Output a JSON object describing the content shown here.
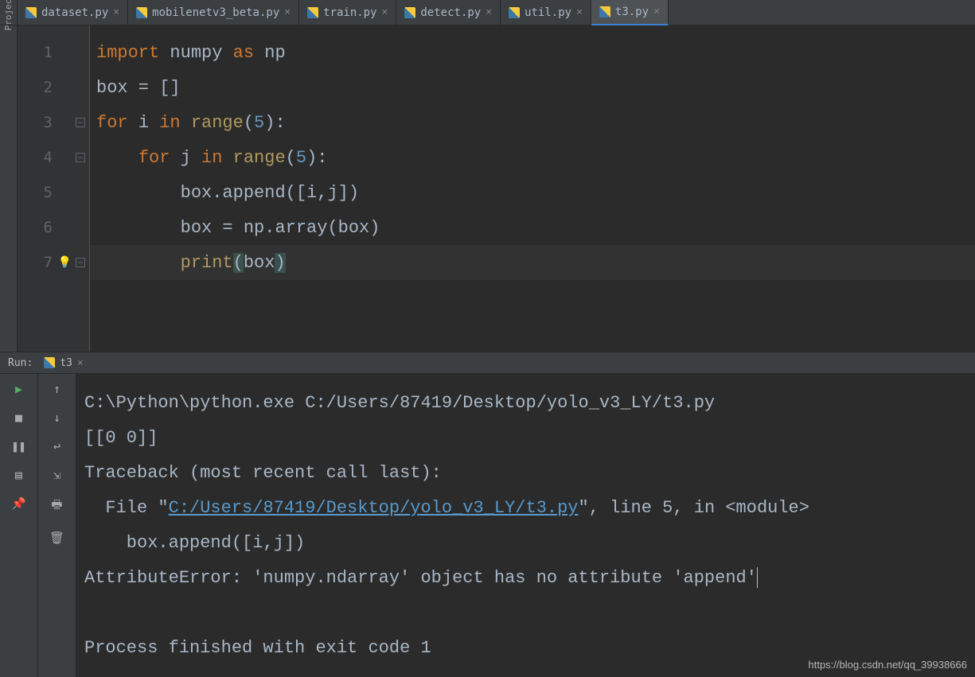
{
  "tabs": [
    {
      "label": "dataset.py",
      "active": false
    },
    {
      "label": "mobilenetv3_beta.py",
      "active": false
    },
    {
      "label": "train.py",
      "active": false
    },
    {
      "label": "detect.py",
      "active": false
    },
    {
      "label": "util.py",
      "active": false
    },
    {
      "label": "t3.py",
      "active": true
    }
  ],
  "sidebar_label": "Project",
  "gutter": {
    "lines": [
      "1",
      "2",
      "3",
      "4",
      "5",
      "6",
      "7"
    ]
  },
  "code": {
    "l1": {
      "kw1": "import ",
      "v": "numpy ",
      "kw2": "as ",
      "alias": "np"
    },
    "l2": {
      "v": "box = []"
    },
    "l3": {
      "kw1": "for ",
      "i": "i ",
      "kw2": "in ",
      "fn": "range",
      "rest": "(5):",
      "n": "5"
    },
    "l4": {
      "pad": "    ",
      "kw1": "for ",
      "i": "j ",
      "kw2": "in ",
      "fn": "range",
      "rest": "(5):",
      "n": "5"
    },
    "l5": {
      "pad": "        ",
      "v": "box.append([i,j])"
    },
    "l6": {
      "pad": "        ",
      "v": "box = np.array(box)"
    },
    "l7": {
      "pad": "        ",
      "fn": "print",
      "lp": "(",
      "arg": "box",
      "rp": ")"
    }
  },
  "run": {
    "label": "Run:",
    "tab": "t3"
  },
  "console": {
    "exec": "C:\\Python\\python.exe C:/Users/87419/Desktop/yolo_v3_LY/t3.py",
    "out": "[[0 0]]",
    "tb": "Traceback (most recent call last):",
    "file_pre": "  File \"",
    "file_link": "C:/Users/87419/Desktop/yolo_v3_LY/t3.py",
    "file_post": "\", line 5, in <module>",
    "src": "    box.append([i,j])",
    "err": "AttributeError: 'numpy.ndarray' object has no attribute 'append'",
    "exit": "Process finished with exit code 1"
  },
  "watermark": "https://blog.csdn.net/qq_39938666"
}
